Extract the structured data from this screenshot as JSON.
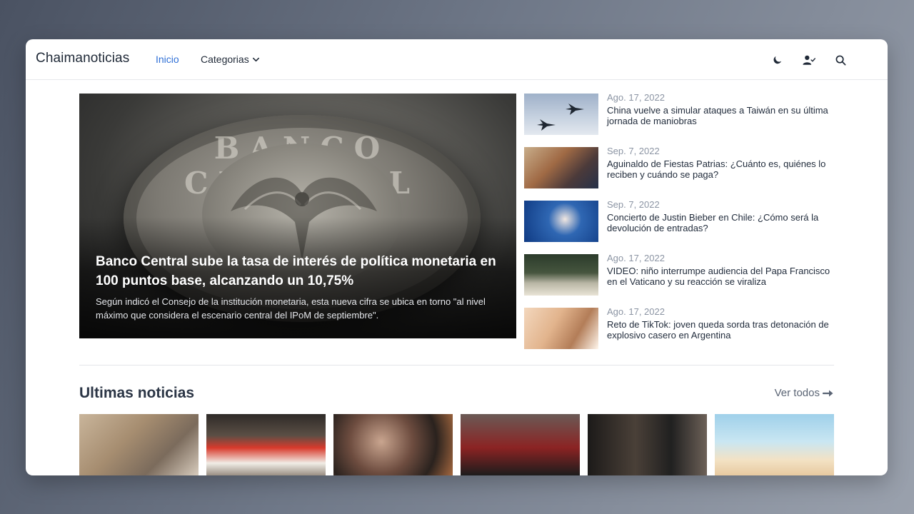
{
  "site": {
    "brand": "Chaimanoticias"
  },
  "nav": {
    "home_label": "Inicio",
    "categories_label": "Categorias"
  },
  "icons": {
    "theme": "moon-icon",
    "user": "user-check-icon",
    "search": "search-icon",
    "dropdown": "chevron-down-icon",
    "arrow": "arrow-right-icon"
  },
  "colors": {
    "accent": "#2f6fd6",
    "text": "#1f2937",
    "muted": "#8b94a3"
  },
  "hero": {
    "title": "Banco Central sube la tasa de interés de política monetaria en 100 puntos base, alcanzando un 10,75%",
    "summary": "Según indicó el Consejo de la institución monetaria, esta nueva cifra se ubica en torno \"al nivel máximo que considera el escenario central del IPoM de septiembre\".",
    "image_text": "BANCO CENTRAL"
  },
  "side_news": [
    {
      "date": "Ago. 17, 2022",
      "title": "China vuelve a simular ataques a Taiwán en su última jornada de maniobras"
    },
    {
      "date": "Sep. 7, 2022",
      "title": "Aguinaldo de Fiestas Patrias: ¿Cuánto es, quiénes lo reciben y cuándo se paga?"
    },
    {
      "date": "Sep. 7, 2022",
      "title": "Concierto de Justin Bieber en Chile: ¿Cómo será la devolución de entradas?"
    },
    {
      "date": "Ago. 17, 2022",
      "title": "VIDEO: niño interrumpe audiencia del Papa Francisco en el Vaticano y su reacción se viraliza"
    },
    {
      "date": "Ago. 17, 2022",
      "title": "Reto de TikTok: joven queda sorda tras detonación de explosivo casero en Argentina"
    }
  ],
  "latest": {
    "title": "Ultimas noticias",
    "see_all": "Ver todos"
  }
}
